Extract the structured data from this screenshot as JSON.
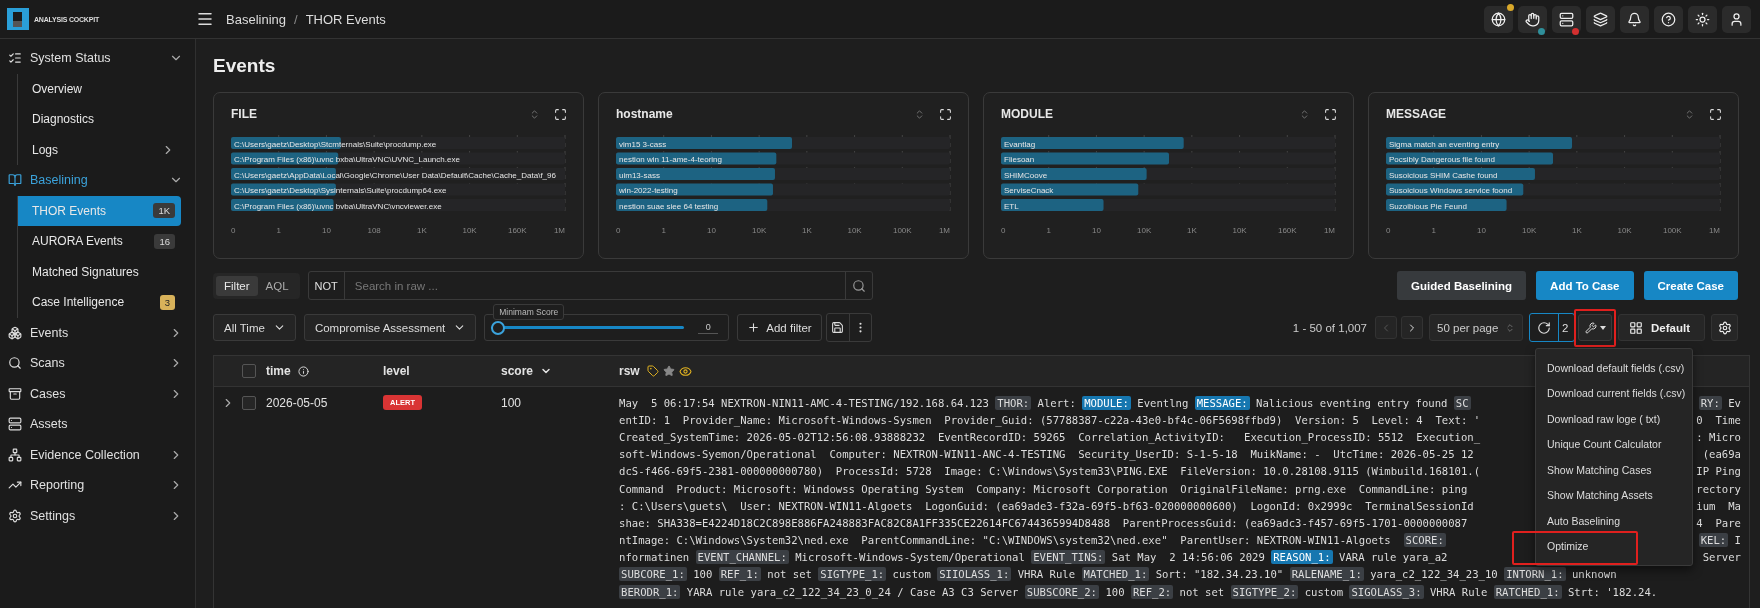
{
  "app": {
    "logo_text": "ANALYSIS COCKPIT"
  },
  "topbar": {
    "breadcrumb": [
      "Baselining",
      "THOR Events"
    ],
    "breadcrumb_separator": "/",
    "notices": [
      {
        "color": "#d9a82a"
      },
      {
        "color": "#2f8f9a"
      },
      {
        "color": "#d32f2f"
      }
    ]
  },
  "sidebar": {
    "items": [
      {
        "label": "System Status",
        "active": false,
        "expanded": true,
        "children": [
          {
            "label": "Overview",
            "selected": false
          },
          {
            "label": "Diagnostics",
            "selected": false
          },
          {
            "label": "Logs",
            "selected": false,
            "expanded": false
          }
        ]
      },
      {
        "label": "Baselining",
        "active": true,
        "expanded": true,
        "children": [
          {
            "label": "THOR Events",
            "selected": true,
            "badge": {
              "text": "1K",
              "color": "#3a3a3a"
            }
          },
          {
            "label": "AURORA Events",
            "selected": false,
            "badge": {
              "text": "16",
              "color": "#3a3a3a"
            }
          },
          {
            "label": "Matched Signatures",
            "selected": false
          },
          {
            "label": "Case Intelligence",
            "selected": false,
            "badge": {
              "text": "3",
              "color": "#d8b25a"
            }
          }
        ]
      },
      {
        "label": "Events",
        "active": false,
        "expanded": false
      },
      {
        "label": "Scans",
        "active": false,
        "expanded": false
      },
      {
        "label": "Cases",
        "active": false,
        "expanded": false
      },
      {
        "label": "Assets",
        "active": false
      },
      {
        "label": "Evidence Collection",
        "active": false,
        "expanded": false
      },
      {
        "label": "Reporting",
        "active": false,
        "expanded": false
      },
      {
        "label": "Settings",
        "active": false,
        "expanded": false
      }
    ]
  },
  "page_title": "Events",
  "charts": [
    {
      "title": "FILE",
      "bars": [
        {
          "label": "C:\\Users\\gaetz\\Desktop\\Stcmternals\\Suite\\procdump.exe",
          "level": 0.329
        },
        {
          "label": "C:\\Program Files (x86)\\uvnc bxba\\UltraVNC\\UVNC_Launch.exe",
          "level": 0.321
        },
        {
          "label": "C:\\Users\\gaetz\\AppData\\Local\\Google\\Chrome\\User Data\\Default\\Cache\\Cache_Data\\f_96",
          "level": 0.314
        },
        {
          "label": "C:\\Users\\gaetz\\Desktop\\Sysinternals\\Suite\\procdump64.exe",
          "level": 0.314
        },
        {
          "label": "C:\\Program Files (x86)\\uvnc bvba\\UltraVNC\\vncviewer.exe",
          "level": 0.307
        }
      ],
      "axis_labels": [
        "0",
        "1",
        "10",
        "108",
        "1K",
        "10K",
        "160K",
        "1M"
      ]
    },
    {
      "title": "hostname",
      "bars": [
        {
          "label": "vim15 3-cass",
          "level": 0.527
        },
        {
          "label": "nestion win 11-ame-4-teoring",
          "level": 0.48
        },
        {
          "label": "uim13-sass",
          "level": 0.476
        },
        {
          "label": "win-2022-testing",
          "level": 0.47
        },
        {
          "label": "nestion suae siee 64 testing",
          "level": 0.453
        }
      ],
      "axis_labels": [
        "0",
        "1",
        "10",
        "10K",
        "1K",
        "10K",
        "100K",
        "1M"
      ]
    },
    {
      "title": "MODULE",
      "bars": [
        {
          "label": "Evantlag",
          "level": 0.547
        },
        {
          "label": "Fliesoan",
          "level": 0.503
        },
        {
          "label": "SHIMCoove",
          "level": 0.436
        },
        {
          "label": "ServiseCnack",
          "level": 0.411
        },
        {
          "label": "ETL",
          "level": 0.307
        }
      ],
      "axis_labels": [
        "0",
        "1",
        "10",
        "10K",
        "1K",
        "10K",
        "160K",
        "1M"
      ]
    },
    {
      "title": "MESSAGE",
      "bars": [
        {
          "label": "Sigma match an eventing entry",
          "level": 0.557
        },
        {
          "label": "Pocsibly Dangerous file found",
          "level": 0.5
        },
        {
          "label": "Susoicious SHIM Cashe found",
          "level": 0.446
        },
        {
          "label": "Susoicious Windows service foond",
          "level": 0.411
        },
        {
          "label": "Suzoibious Pie Feund",
          "level": 0.361
        }
      ],
      "axis_labels": [
        "0",
        "1",
        "10",
        "10K",
        "1K",
        "10K",
        "100K",
        "1M"
      ]
    }
  ],
  "search_bar": {
    "modes": [
      {
        "label": "Filter",
        "selected": true
      },
      {
        "label": "AQL",
        "selected": false
      }
    ],
    "not_label": "NOT",
    "placeholder": "Search in raw ..."
  },
  "actions": [
    {
      "label": "Guided Baselining",
      "kind": "secondary"
    },
    {
      "label": "Add To Case",
      "kind": "primary"
    },
    {
      "label": "Create Case",
      "kind": "primary"
    }
  ],
  "filters": {
    "time": "All Time",
    "view": "Compromise Assessment",
    "min_score": {
      "label": "Minimam Score",
      "level": 0,
      "value": "0"
    },
    "add_filter": "Add filter"
  },
  "pagination": {
    "range": "1 - 50 of 1,007",
    "prev_disabled": true,
    "page_size": "50 per page",
    "refresh_count": "2",
    "tools_highlighted": true,
    "layout": "Default"
  },
  "table": {
    "header_checked": false,
    "columns": [
      {
        "label": "time",
        "kind": "info"
      },
      {
        "label": "level",
        "kind": "plain"
      },
      {
        "label": "score",
        "kind": "sorted"
      },
      {
        "label": "rsw",
        "kind": "tools"
      }
    ],
    "rows": [
      {
        "expanded": false,
        "checked": false,
        "time": "2026-05-05",
        "level": "ALERT",
        "score": "100",
        "raw_lines": [
          {
            "left": [
              {
                "kind": "text",
                "text": "May  5 06:17:54 NEXTRON-NIN11-AMC-4-TESTING/192.168.64.123 "
              },
              {
                "kind": "key",
                "text": "THOR:"
              },
              {
                "kind": "text",
                "text": " Alert: "
              },
              {
                "kind": "match",
                "text": "MODULE:"
              },
              {
                "kind": "text",
                "text": " Eventlng "
              },
              {
                "kind": "match",
                "text": "MESSAGE:"
              },
              {
                "kind": "text",
                "text": " Nalicious eventing entry found "
              },
              {
                "kind": "key",
                "text": "SC"
              }
            ],
            "right": [
              {
                "kind": "key",
                "text": "RY:"
              },
              {
                "kind": "text",
                "text": " Ev"
              }
            ]
          },
          {
            "left": [
              {
                "kind": "text",
                "text": "entID: 1  Provider_Name: Microsoft-Windows-Sysmen  Provider_Guid: (57788387-c22a-43e0-bf4c-06F5698ffbd9)  Version: 5  Level: 4  Text: '"
              }
            ],
            "right": [
              {
                "kind": "text",
                "text": "0  Time"
              }
            ]
          },
          {
            "left": [
              {
                "kind": "text",
                "text": "Created_SystemTime: 2026-05-02T12:56:08.93888232  EventRecordID: 59265  Correlation_ActivityID:   Execution_ProcessID: 5512  Execution_"
              }
            ],
            "right": [
              {
                "kind": "text",
                "text": ": Micro"
              }
            ]
          },
          {
            "left": [
              {
                "kind": "text",
                "text": "soft-Windows-Syemon/Operational  Computer: NEXTRON-WIN11-ANC-4-TESTING  Security_UserID: S-1-5-18  MuikName: -  UtcTime: 2026-05-25 12"
              }
            ],
            "right": [
              {
                "kind": "text",
                "text": "(ea69a"
              }
            ]
          },
          {
            "left": [
              {
                "kind": "text",
                "text": "dcS-f466-69f5-2381-000000000780)  ProcessId: 5728  Image: C:\\Windows\\System33\\PING.EXE  FileVersion: 10.0.28108.9115 (Wimbuild.168101.("
              }
            ],
            "right": [
              {
                "kind": "text",
                "text": "IP Ping"
              }
            ]
          },
          {
            "left": [
              {
                "kind": "text",
                "text": "Command  Product: Microsoft: Windowss Operating System  Company: Microsoft Corporation  OriginalFileName: prng.exe  CommandLine: ping"
              }
            ],
            "right": [
              {
                "kind": "text",
                "text": "rectory"
              }
            ]
          },
          {
            "left": [
              {
                "kind": "text",
                "text": ": C:\\Users\\guets\\  User: NEXTRON-WIN11-Algoets  LogonGuid: (ea69ade3-f32a-69f5-bf63-020000000600)  LogonId: 0x2999c  TerminalSessionId"
              }
            ],
            "right": [
              {
                "kind": "text",
                "text": "ium  Ma"
              }
            ]
          },
          {
            "left": [
              {
                "kind": "text",
                "text": "shae: SHA338=E4224D18C2C898E886FA248883FAC82C8A1FF335CE22614FC6744365994D8488  ParentProcessGuid: (ea69adc3-f457-69f5-1701-0000000087"
              }
            ],
            "right": [
              {
                "kind": "text",
                "text": "4  Pare"
              }
            ]
          },
          {
            "left": [
              {
                "kind": "text",
                "text": "ntImage: C:\\Windows\\System32\\ned.exe  ParentCommandLine: \"C:\\WINDOWS\\system32\\ned.exe\"  ParentUser: NEXTRON-WIN11-Algoets  "
              },
              {
                "kind": "key",
                "text": "SCORE:"
              }
            ],
            "right": [
              {
                "kind": "key",
                "text": "KEL:"
              },
              {
                "kind": "text",
                "text": " I"
              }
            ]
          },
          {
            "left": [
              {
                "kind": "text",
                "text": "nformatinen "
              },
              {
                "kind": "key",
                "text": "EVENT_CHANNEL:"
              },
              {
                "kind": "text",
                "text": " Microsoft-Windows-System/Operational "
              },
              {
                "kind": "key",
                "text": "EVENT_TINS:"
              },
              {
                "kind": "text",
                "text": " Sat May  2 14:56:06 2029 "
              },
              {
                "kind": "match",
                "text": "REASON_1:"
              },
              {
                "kind": "text",
                "text": " VARA rule yara_a2"
              }
            ],
            "right": [
              {
                "kind": "text",
                "text": " Server"
              }
            ]
          },
          {
            "left": [
              {
                "kind": "key",
                "text": "SUBCORE_1:"
              },
              {
                "kind": "text",
                "text": " 100 "
              },
              {
                "kind": "key",
                "text": "REF_1:"
              },
              {
                "kind": "text",
                "text": " not set "
              },
              {
                "kind": "key",
                "text": "SIGTYPE_1:"
              },
              {
                "kind": "text",
                "text": " custom "
              },
              {
                "kind": "key",
                "text": "SIIOLASS_1:"
              },
              {
                "kind": "text",
                "text": " VHRA Rule "
              },
              {
                "kind": "key",
                "text": "MATCHED_1:"
              },
              {
                "kind": "text",
                "text": " Sort: \"182.34.23.10\" "
              },
              {
                "kind": "key",
                "text": "RALENAME_1:"
              },
              {
                "kind": "text",
                "text": " yara_c2_122_34_23_10 "
              },
              {
                "kind": "key",
                "text": "INTORN_1:"
              },
              {
                "kind": "text",
                "text": " unknown"
              }
            ]
          },
          {
            "left": [
              {
                "kind": "key",
                "text": "BERODR_1:"
              },
              {
                "kind": "text",
                "text": " YARA rule yara_c2_122_34_23_0_24 / Case A3 C3 Server "
              },
              {
                "kind": "key",
                "text": "SUBSCORE_2:"
              },
              {
                "kind": "text",
                "text": " 100 "
              },
              {
                "kind": "key",
                "text": "REF_2:"
              },
              {
                "kind": "text",
                "text": " not set "
              },
              {
                "kind": "key",
                "text": "SIGTYPE_2:"
              },
              {
                "kind": "text",
                "text": " custom "
              },
              {
                "kind": "key",
                "text": "SIGOLASS_3:"
              },
              {
                "kind": "text",
                "text": " VHRA Rule "
              },
              {
                "kind": "key",
                "text": "RATCHED_1:"
              },
              {
                "kind": "text",
                "text": " Strt: '182.24."
              }
            ]
          }
        ]
      }
    ]
  },
  "menu": {
    "items": [
      {
        "label": "Download default fields (.csv)",
        "highlighted": false
      },
      {
        "label": "Download current fields (.csv)",
        "highlighted": false
      },
      {
        "label": "Download raw loge ( txt)",
        "highlighted": false
      },
      {
        "label": "Unique Count Calculator",
        "highlighted": false
      },
      {
        "label": "Show Matching Cases",
        "highlighted": false
      },
      {
        "label": "Show Matching Assets",
        "highlighted": false
      },
      {
        "label": "Auto Baselining",
        "highlighted": false
      },
      {
        "label": "Optimize",
        "highlighted": true
      }
    ]
  }
}
